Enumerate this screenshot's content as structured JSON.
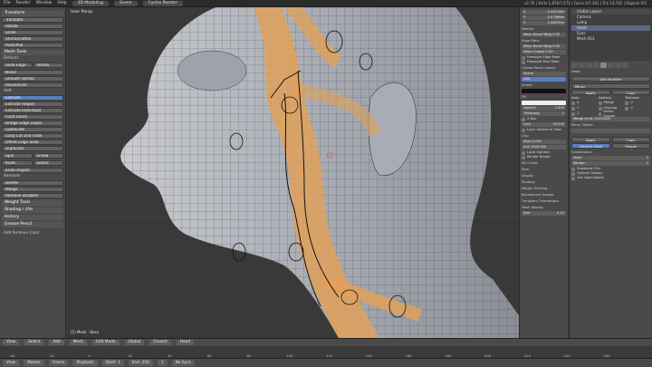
{
  "topbar": {
    "menus": [
      "File",
      "Render",
      "Window",
      "Help"
    ],
    "screen_layout": "3D Modeling",
    "scene": "Scene",
    "render_engine": "Cycles Render",
    "info": "v2.79 | Verts 1,876/7,472 | Faces 0/7,381 | Tris 14,762 | Objects 0/5"
  },
  "toolshelf": {
    "transform_header": "Transform",
    "transform_tools": [
      "Translate",
      "Rotate",
      "Scale",
      "Shrink/Fatten",
      "Push/Pull"
    ],
    "mesh_tools_header": "Mesh Tools",
    "deform_label": "Deform:",
    "deform_tools": [
      "Slide Edge",
      "Vertex"
    ],
    "more_tools": [
      "Noise",
      "Smooth Vertex",
      "Randomize"
    ],
    "add_label": "Add:",
    "add_tools": [
      "Extrude",
      "Extrude Region",
      "Extrude Individual",
      "Inset Faces",
      "Bridge Edge Loops",
      "Subdivide",
      "Loop Cut and Slide",
      "Offset Edge Slide",
      "Duplicate"
    ],
    "spin_row": [
      "Spin",
      "Screw"
    ],
    "knife_row": [
      "Knife",
      "Select"
    ],
    "knife_project": "Knife Project",
    "remove_label": "Remove:",
    "remove_tools": [
      "Delete",
      "Merge",
      "Remove Doubles"
    ],
    "collapsed_panels": [
      "Weight Tools",
      "Shading / UVs",
      "History",
      "Grease Pencil"
    ],
    "bottom_label": "Add Remove Color"
  },
  "viewport": {
    "label": "User Persp",
    "object_label": "(1) Mesh : Base"
  },
  "npanel": {
    "transform_fields": [
      {
        "axis": "X",
        "value": "0.34276m"
      },
      {
        "axis": "Y",
        "value": "-0.07566m"
      },
      {
        "axis": "Z",
        "value": "1.58250m"
      }
    ],
    "median_label": "Median:",
    "mean_bevel_weight": "Mean Bevel Weig 0.00",
    "edge_data_label": "Edge Data:",
    "edge_bevel_weight": "Mean Bevel Weig 0.00",
    "mean_crease": "Mean Crease 0.00",
    "freestyle_checks": [
      "Freestyle Edge Mark",
      "Freestyle Face Mark"
    ],
    "grease_pencil_label": "Grease Pencil Layers",
    "scene_label": "Scene",
    "object_label": "Object",
    "layer_name": "Line",
    "stroke_label": "Stroke",
    "fill_label": "Fill",
    "opacity_label": "Opacity",
    "opacity_value": "1.000",
    "onion_label": "Onion Skinning",
    "thickness_label": "Thickness",
    "thickness_value": "1",
    "xray_label": "X Ray",
    "volumetric_label": "Volumetric Strokes",
    "lens_label": "Lens",
    "lens_value": "35.000",
    "view_camera_label": "Lock Camera to View",
    "lock_to_object_label": "Lock to Object",
    "lock_to_cursor_label": "Lock to Cursor",
    "clip_label": "Clip:",
    "clip_start": "Start 0.001",
    "clip_end": "End 1000.000",
    "local_camera_label": "Local Camera",
    "render_border_label": "Render Border",
    "cursor_label": "3D Cursor",
    "item_label": "Item",
    "display_label": "Display",
    "shading_label": "Shading",
    "motion_tracking_label": "Motion Tracking",
    "background_images_label": "Background Images",
    "transform_orient_label": "Transform Orientations",
    "mesh_display_label": "Mesh Display",
    "normals_label": "Normals",
    "size_label": "Size",
    "size_value": "0.10",
    "measurement_label": "Measurement",
    "color_label": "Color",
    "decimals_value": "1"
  },
  "outliner": {
    "header": "Visible Layers",
    "items": [
      "Camera",
      "Lamp",
      "Head",
      "Eyes",
      "Mesh.001"
    ]
  },
  "propeditor": {
    "object_name": "Head",
    "add_modifier": "Add Modifier",
    "modifier_name": "Mirror",
    "apply_label": "Apply",
    "copy_label": "Copy",
    "axis_label": "Axis:",
    "options_label": "Options:",
    "texture_label": "Textures:",
    "axes": [
      "X",
      "Y",
      "Z"
    ],
    "option_items": [
      "Merge",
      "Clipping",
      "Vertex Groups"
    ],
    "texture_items": [
      "U",
      "V"
    ],
    "merge_limit": "Merge Limit: 0.001000",
    "mirror_object": "Mirror Object:",
    "subsurf_apply": "Apply",
    "subsurf_copy": "Copy",
    "subdivisions_label": "Subdivisions:",
    "catmull_clark": "Catmull-Clark",
    "simple": "Simple",
    "view_label": "View:",
    "view_value": "2",
    "render_label": "Render:",
    "render_value": "2",
    "options2": [
      "Subdivide UVs",
      "Optimal Display",
      "Use OpenSubdiv"
    ]
  },
  "viewport_header": {
    "items": [
      "View",
      "Select",
      "Add",
      "Mesh"
    ],
    "mode": "Edit Mode",
    "pivot": "Global",
    "snapping": "Closest",
    "object_name": "Head"
  },
  "timeline": {
    "ticks": [
      "-40",
      "-20",
      "0",
      "20",
      "40",
      "60",
      "80",
      "100",
      "120",
      "140",
      "160",
      "180",
      "200",
      "220",
      "240",
      "260"
    ]
  },
  "bottombar": {
    "items": [
      "View",
      "Marker",
      "Frame",
      "Playback"
    ],
    "start": "Start: 1",
    "end": "End: 250",
    "current": "1",
    "sync": "No Sync"
  },
  "colors": {
    "accent": "#5680c2",
    "mask_orange": "#e0a15a",
    "skin": "#b0b3bb"
  }
}
